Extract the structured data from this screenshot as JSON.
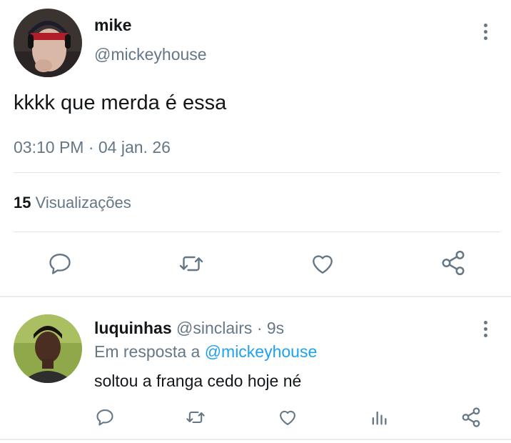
{
  "tweet": {
    "author_name": "mike",
    "author_handle": "@mickeyhouse",
    "text": "kkkk que merda é essa",
    "timestamp": "03:10 PM · 04 jan. 26",
    "views_count": "15",
    "views_label": "Visualizações",
    "actions": [
      "reply-icon",
      "retweet-icon",
      "like-icon",
      "share-icon"
    ]
  },
  "reply": {
    "author_name": "luquinhas",
    "author_handle": "@sinclairs",
    "age": "· 9s",
    "in_reply_prefix": "Em resposta a",
    "in_reply_handle": "@mickeyhouse",
    "text": "soltou a franga cedo hoje né",
    "actions": [
      "reply-icon",
      "retweet-icon",
      "like-icon",
      "analytics-icon",
      "share-icon"
    ]
  },
  "colors": {
    "text": "#14171a",
    "muted": "#657786",
    "link": "#1da1f2",
    "divider": "#e1e8ed"
  }
}
